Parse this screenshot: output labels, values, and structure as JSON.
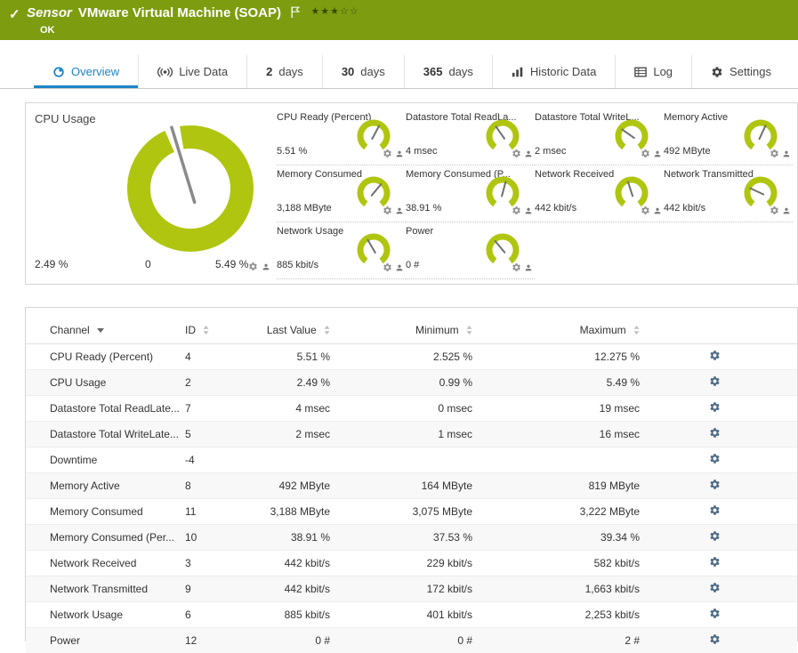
{
  "colors": {
    "header_bar": "#7d9c10",
    "gauge_green": "#b0c50f",
    "accent_blue": "#1d84c6"
  },
  "header": {
    "check": "✓",
    "kind": "Sensor",
    "title": "VMware Virtual Machine (SOAP)",
    "status": "OK",
    "stars": {
      "filled": 3,
      "total": 5
    }
  },
  "tabs": {
    "overview": {
      "label": "Overview"
    },
    "live_data": {
      "label": "Live Data"
    },
    "d2": {
      "num": "2",
      "unit": "days"
    },
    "d30": {
      "num": "30",
      "unit": "days"
    },
    "d365": {
      "num": "365",
      "unit": "days"
    },
    "historic": {
      "label": "Historic Data"
    },
    "log": {
      "label": "Log"
    },
    "settings": {
      "label": "Settings"
    }
  },
  "gauges": {
    "big": {
      "title": "CPU Usage",
      "value": "2.49 %",
      "min": "0",
      "max": "5.49 %",
      "needle_deg": -17
    },
    "minis": [
      {
        "title": "CPU Ready (Percent)",
        "value": "5.51 %",
        "needle_deg": 28
      },
      {
        "title": "Datastore Total ReadLa...",
        "value": "4 msec",
        "needle_deg": -35
      },
      {
        "title": "Datastore Total WriteL...",
        "value": "2 msec",
        "needle_deg": -55
      },
      {
        "title": "Memory Active",
        "value": "492 MByte",
        "needle_deg": 25
      },
      {
        "title": "Memory Consumed",
        "value": "3,188 MByte",
        "needle_deg": 40
      },
      {
        "title": "Memory Consumed (P...",
        "value": "38.91 %",
        "needle_deg": 15
      },
      {
        "title": "Network Received",
        "value": "442 kbit/s",
        "needle_deg": -18
      },
      {
        "title": "Network Transmitted",
        "value": "442 kbit/s",
        "needle_deg": -65
      },
      {
        "title": "Network Usage",
        "value": "885 kbit/s",
        "needle_deg": -30
      },
      {
        "title": "Power",
        "value": "0 #",
        "needle_deg": -40
      }
    ]
  },
  "table": {
    "columns": [
      "Channel",
      "ID",
      "Last Value",
      "Minimum",
      "Maximum"
    ],
    "rows": [
      [
        "CPU Ready (Percent)",
        "4",
        "5.51 %",
        "2.525 %",
        "12.275 %"
      ],
      [
        "CPU Usage",
        "2",
        "2.49 %",
        "0.99 %",
        "5.49 %"
      ],
      [
        "Datastore Total ReadLate...",
        "7",
        "4 msec",
        "0 msec",
        "19 msec"
      ],
      [
        "Datastore Total WriteLate...",
        "5",
        "2 msec",
        "1 msec",
        "16 msec"
      ],
      [
        "Downtime",
        "-4",
        "",
        "",
        ""
      ],
      [
        "Memory Active",
        "8",
        "492 MByte",
        "164 MByte",
        "819 MByte"
      ],
      [
        "Memory Consumed",
        "11",
        "3,188 MByte",
        "3,075 MByte",
        "3,222 MByte"
      ],
      [
        "Memory Consumed (Per...",
        "10",
        "38.91 %",
        "37.53 %",
        "39.34 %"
      ],
      [
        "Network Received",
        "3",
        "442 kbit/s",
        "229 kbit/s",
        "582 kbit/s"
      ],
      [
        "Network Transmitted",
        "9",
        "442 kbit/s",
        "172 kbit/s",
        "1,663 kbit/s"
      ],
      [
        "Network Usage",
        "6",
        "885 kbit/s",
        "401 kbit/s",
        "2,253 kbit/s"
      ],
      [
        "Power",
        "12",
        "0 #",
        "0 #",
        "2 #"
      ]
    ]
  }
}
